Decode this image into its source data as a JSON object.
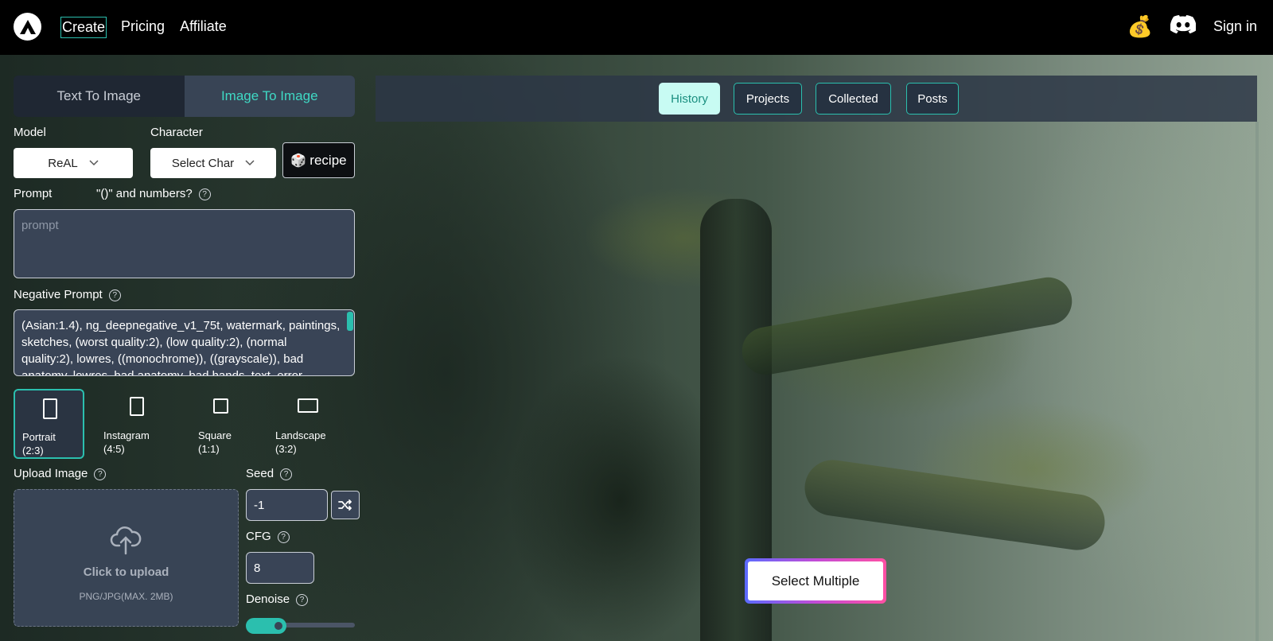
{
  "nav": {
    "links": [
      "Create",
      "Pricing",
      "Affiliate"
    ],
    "signin": "Sign in",
    "money_icon": "💰"
  },
  "mode_tabs": [
    "Text To Image",
    "Image To Image"
  ],
  "form": {
    "model_label": "Model",
    "model_value": "ReAL",
    "character_label": "Character",
    "character_value": "Select Char",
    "recipe_label": "recipe",
    "recipe_icon": "🎲",
    "prompt_label": "Prompt",
    "prompt_hint": "\"()\" and numbers?",
    "prompt_placeholder": "prompt",
    "negative_label": "Negative Prompt",
    "negative_value": "(Asian:1.4), ng_deepnegative_v1_75t, watermark, paintings, sketches, (worst quality:2), (low quality:2), (normal quality:2), lowres, ((monochrome)), ((grayscale)), bad anatomy, lowres, bad anatomy, bad hands, text, error",
    "ratios": [
      {
        "name": "Portrait",
        "ratio": "(2:3)"
      },
      {
        "name": "Instagram",
        "ratio": "(4:5)"
      },
      {
        "name": "Square",
        "ratio": "(1:1)"
      },
      {
        "name": "Landscape",
        "ratio": "(3:2)"
      }
    ],
    "upload_label": "Upload Image",
    "upload_title": "Click to upload",
    "upload_sub": "PNG/JPG(MAX. 2MB)",
    "seed_label": "Seed",
    "seed_value": "-1",
    "cfg_label": "CFG",
    "cfg_value": "8",
    "denoise_label": "Denoise",
    "denoise_value": 0.3
  },
  "gallery": {
    "tabs": [
      "History",
      "Projects",
      "Collected",
      "Posts"
    ],
    "select_multiple": "Select Multiple"
  },
  "colors": {
    "accent": "#2bbfae",
    "panel": "#384455"
  }
}
